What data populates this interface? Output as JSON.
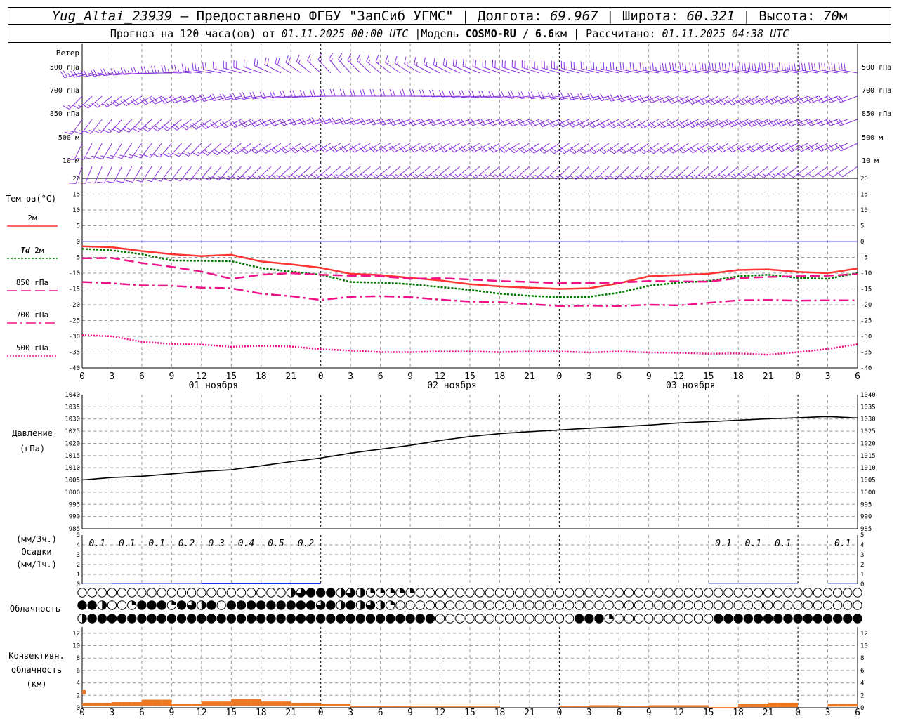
{
  "header": {
    "station": "Yug_Altai_23939",
    "provider": " — Предоставлено ФГБУ \"ЗапСиб УГМС\" | Долгота: ",
    "lon": "69.967",
    "lat_label": " | Широта: ",
    "lat": "60.321",
    "alt_label": " | Высота: ",
    "alt": "70",
    "alt_unit": "м",
    "forecast_prefix": "Прогноз на 120 часа(ов) от ",
    "forecast_start": "01.11.2025 00:00 UTC",
    "model_label": " |Модель ",
    "model_name": "COSMO-RU / 6.6",
    "model_unit": "км",
    "calc_label": " | Рассчитано: ",
    "calc_time": "01.11.2025 04:38 UTC"
  },
  "colors": {
    "t2m": "#ff3333",
    "td2m": "#007700",
    "t850": "#ee1188",
    "t700": "#ee1188",
    "t500": "#ee1188",
    "pressure": "#000000",
    "precip": "#1133ee",
    "convective": "#ee7722",
    "wind": "#8833dd",
    "zero_line": "#5555ff"
  },
  "chart_data": [
    {
      "type": "wind-barbs",
      "title": "Ветер",
      "levels": [
        "500 гПа",
        "700 гПа",
        "850 гПа",
        "500 м",
        "10 м"
      ],
      "time_step_h": 1,
      "direction_from_deg": [
        [
          255,
          270,
          290,
          320,
          300,
          290,
          285,
          280,
          280,
          280
        ],
        [
          225,
          245,
          260,
          270,
          270,
          265,
          260,
          250,
          240,
          250
        ],
        [
          215,
          230,
          245,
          255,
          250,
          250,
          245,
          240,
          245,
          250
        ],
        [
          205,
          220,
          235,
          240,
          240,
          240,
          235,
          235,
          240,
          245
        ],
        [
          200,
          215,
          225,
          230,
          230,
          230,
          225,
          225,
          230,
          235
        ]
      ],
      "speed_knots": [
        [
          25,
          25,
          20,
          15,
          15,
          20,
          25,
          25,
          35,
          30
        ],
        [
          15,
          20,
          20,
          20,
          20,
          20,
          20,
          20,
          25,
          20
        ],
        [
          15,
          20,
          20,
          20,
          20,
          20,
          20,
          20,
          25,
          20
        ],
        [
          15,
          15,
          20,
          20,
          20,
          20,
          20,
          20,
          20,
          20
        ],
        [
          10,
          10,
          15,
          15,
          15,
          15,
          15,
          15,
          15,
          10
        ]
      ]
    },
    {
      "type": "line",
      "title": "Тем-ра(°С)",
      "x_ticks": [
        "0",
        "3",
        "6",
        "9",
        "12",
        "15",
        "18",
        "21",
        "0",
        "3",
        "6",
        "9",
        "12",
        "15",
        "18",
        "21",
        "0",
        "3",
        "6",
        "9",
        "12",
        "15",
        "18",
        "21",
        "0",
        "3",
        "6"
      ],
      "day_labels": [
        "01 ноября",
        "02 ноября",
        "03 ноября"
      ],
      "ylim": [
        -40,
        20
      ],
      "yticks": [
        20,
        15,
        10,
        5,
        0,
        -5,
        -10,
        -15,
        -20,
        -25,
        -30,
        -35,
        -40
      ],
      "series": [
        {
          "name": "2м",
          "style": "solid",
          "hours": [
            0,
            3,
            6,
            9,
            12,
            15,
            18,
            21,
            24,
            27,
            30,
            33,
            36,
            39,
            42,
            45,
            48,
            51,
            54,
            57,
            60,
            63,
            66,
            69,
            72,
            75,
            78
          ],
          "values": [
            -1.5,
            -1.8,
            -3,
            -4,
            -4.6,
            -4.2,
            -6.3,
            -7.2,
            -8.3,
            -10.2,
            -10.6,
            -11.5,
            -12.3,
            -13.5,
            -14.2,
            -14.6,
            -15,
            -14.8,
            -13.2,
            -11,
            -10.6,
            -10.2,
            -9,
            -8.8,
            -9.6,
            -10,
            -8.5
          ]
        },
        {
          "name": "Td 2м",
          "style": "dotted",
          "hours": [
            0,
            3,
            6,
            9,
            12,
            15,
            18,
            21,
            24,
            27,
            30,
            33,
            36,
            39,
            42,
            45,
            48,
            51,
            54,
            57,
            60,
            63,
            66,
            69,
            72,
            75,
            78
          ],
          "values": [
            -2.3,
            -2.8,
            -4,
            -6,
            -6.1,
            -6.2,
            -8.4,
            -9.5,
            -10.5,
            -12.8,
            -13,
            -13.5,
            -14.4,
            -15.3,
            -16.5,
            -17.2,
            -17.6,
            -17.5,
            -16.2,
            -14,
            -13,
            -12.5,
            -11,
            -10.5,
            -11.5,
            -11.8,
            -10
          ]
        },
        {
          "name": "850 гПа",
          "style": "dashed",
          "hours": [
            0,
            3,
            6,
            9,
            12,
            15,
            18,
            21,
            24,
            27,
            30,
            33,
            36,
            39,
            42,
            45,
            48,
            51,
            54,
            57,
            60,
            63,
            66,
            69,
            72,
            75,
            78
          ],
          "values": [
            -5.3,
            -5.2,
            -6.8,
            -8,
            -9.5,
            -11.8,
            -10.5,
            -10,
            -10.5,
            -10.8,
            -11,
            -11.8,
            -11.6,
            -12,
            -12.5,
            -12.8,
            -13.2,
            -13.1,
            -13,
            -12.5,
            -12.6,
            -12.7,
            -11.6,
            -11.2,
            -11,
            -10.8,
            -10.3
          ]
        },
        {
          "name": "700 гПа",
          "style": "dashdot",
          "hours": [
            0,
            3,
            6,
            9,
            12,
            15,
            18,
            21,
            24,
            27,
            30,
            33,
            36,
            39,
            42,
            45,
            48,
            51,
            54,
            57,
            60,
            63,
            66,
            69,
            72,
            75,
            78
          ],
          "values": [
            -12.8,
            -13.2,
            -13.9,
            -14,
            -14.6,
            -14.8,
            -16.5,
            -17.3,
            -18.5,
            -17.5,
            -17.3,
            -17.6,
            -18.4,
            -19,
            -19.2,
            -19.8,
            -20.4,
            -20.3,
            -20.4,
            -20,
            -20.2,
            -19.4,
            -18.6,
            -18.5,
            -18.7,
            -18.6,
            -18.6
          ]
        },
        {
          "name": "500 гПа",
          "style": "fine-dotted",
          "hours": [
            0,
            3,
            6,
            9,
            12,
            15,
            18,
            21,
            24,
            27,
            30,
            33,
            36,
            39,
            42,
            45,
            48,
            51,
            54,
            57,
            60,
            63,
            66,
            69,
            72,
            75,
            78
          ],
          "values": [
            -29.6,
            -30,
            -31.7,
            -32.4,
            -32.6,
            -33.3,
            -33,
            -33.2,
            -34.1,
            -34.5,
            -35,
            -35,
            -34.8,
            -34.8,
            -35,
            -34.8,
            -34.8,
            -35.1,
            -34.8,
            -35.1,
            -35.2,
            -35.5,
            -35.4,
            -35.8,
            -35,
            -34,
            -32.5
          ]
        }
      ]
    },
    {
      "type": "line",
      "title": "Давление",
      "unit": "(гПа)",
      "ylim": [
        985,
        1040
      ],
      "yticks": [
        1040,
        1035,
        1030,
        1025,
        1020,
        1015,
        1010,
        1005,
        1000,
        995,
        990,
        985
      ],
      "hours": [
        0,
        3,
        6,
        9,
        12,
        15,
        18,
        21,
        24,
        27,
        30,
        33,
        36,
        39,
        42,
        45,
        48,
        51,
        54,
        57,
        60,
        63,
        66,
        69,
        72,
        75,
        78
      ],
      "values": [
        1005,
        1006,
        1006.5,
        1007.5,
        1008.5,
        1009.2,
        1010.8,
        1012.5,
        1014,
        1016,
        1017.6,
        1019.2,
        1021.2,
        1022.8,
        1024,
        1024.8,
        1025.5,
        1026.2,
        1026.8,
        1027.5,
        1028.4,
        1028.9,
        1029.5,
        1030.1,
        1030.5,
        1031,
        1030.4
      ]
    },
    {
      "type": "bar",
      "title": "Осадки",
      "unit3h": "(мм/3ч.)",
      "unit1h": "(мм/1ч.)",
      "ylim": [
        0,
        5
      ],
      "yticks": [
        5,
        4,
        3,
        2,
        1,
        0
      ],
      "amount_labels": [
        {
          "hour": 1.5,
          "text": "0.1"
        },
        {
          "hour": 4.5,
          "text": "0.1"
        },
        {
          "hour": 7.5,
          "text": "0.1"
        },
        {
          "hour": 10.5,
          "text": "0.2"
        },
        {
          "hour": 13.5,
          "text": "0.3"
        },
        {
          "hour": 16.5,
          "text": "0.4"
        },
        {
          "hour": 19.5,
          "text": "0.5"
        },
        {
          "hour": 22.5,
          "text": "0.2"
        },
        {
          "hour": 64.5,
          "text": "0.1"
        },
        {
          "hour": 67.5,
          "text": "0.1"
        },
        {
          "hour": 70.5,
          "text": "0.1"
        },
        {
          "hour": 76.5,
          "text": "0.1"
        }
      ],
      "hours": [
        0,
        3,
        6,
        9,
        12,
        15,
        18,
        21,
        24,
        27,
        30,
        33,
        36,
        39,
        42,
        45,
        48,
        51,
        54,
        57,
        60,
        63,
        66,
        69,
        72,
        75,
        78
      ],
      "values_1h": [
        0.02,
        0.04,
        0.04,
        0.04,
        0.07,
        0.1,
        0.13,
        0.1,
        0,
        0,
        0,
        0,
        0,
        0,
        0,
        0,
        0,
        0,
        0,
        0,
        0,
        0.03,
        0.03,
        0.03,
        0,
        0.03,
        0.03
      ]
    },
    {
      "type": "cloud-symbols",
      "title": "Облачность",
      "time_step_h": 1,
      "rows": [
        {
          "level": "upper",
          "cover_eighths": [
            [
              0,
              0
            ],
            [
              20,
              0
            ],
            [
              21,
              4
            ],
            [
              22,
              6
            ],
            [
              23,
              8
            ],
            [
              25,
              8
            ],
            [
              26,
              4
            ],
            [
              27,
              6
            ],
            [
              28,
              4
            ],
            [
              29,
              2
            ],
            [
              33,
              2
            ],
            [
              34,
              0
            ],
            [
              78,
              0
            ]
          ]
        },
        {
          "level": "middle",
          "cover_eighths": [
            [
              0,
              8
            ],
            [
              1,
              8
            ],
            [
              2,
              4
            ],
            [
              3,
              0
            ],
            [
              5,
              2
            ],
            [
              6,
              8
            ],
            [
              9,
              2
            ],
            [
              10,
              8
            ],
            [
              11,
              6
            ],
            [
              12,
              4
            ],
            [
              13,
              8
            ],
            [
              14,
              0
            ],
            [
              15,
              8
            ],
            [
              23,
              8
            ],
            [
              24,
              6
            ],
            [
              25,
              8
            ],
            [
              26,
              4
            ],
            [
              27,
              8
            ],
            [
              28,
              4
            ],
            [
              29,
              6
            ],
            [
              30,
              4
            ],
            [
              31,
              2
            ],
            [
              32,
              0
            ],
            [
              78,
              0
            ]
          ]
        },
        {
          "level": "lower",
          "cover_eighths": [
            [
              0,
              4
            ],
            [
              1,
              8
            ],
            [
              35,
              8
            ],
            [
              36,
              0
            ],
            [
              49,
              0
            ],
            [
              50,
              8
            ],
            [
              52,
              8
            ],
            [
              53,
              2
            ],
            [
              54,
              0
            ],
            [
              63,
              0
            ],
            [
              64,
              8
            ],
            [
              78,
              8
            ]
          ]
        }
      ]
    },
    {
      "type": "bar",
      "title": "Конвективн. облачность",
      "unit": "(км)",
      "ylim": [
        0,
        13
      ],
      "yticks": [
        12,
        10,
        8,
        6,
        4,
        2,
        0
      ],
      "hours": [
        0,
        3,
        6,
        9,
        12,
        15,
        18,
        21,
        24,
        27,
        30,
        33,
        36,
        39,
        42,
        45,
        48,
        51,
        54,
        57,
        60,
        63,
        66,
        69,
        72,
        75,
        78
      ],
      "top_km": [
        0.8,
        0.9,
        1.3,
        0.6,
        1.0,
        1.4,
        1.0,
        0.8,
        0.6,
        0.3,
        0.3,
        0.2,
        0.2,
        0.2,
        0.1,
        0,
        0.3,
        0.4,
        0.3,
        0.4,
        0.4,
        0.1,
        0.6,
        0.8,
        0,
        0.6,
        0.8
      ],
      "base_km": [
        0.3,
        0.3,
        0.3,
        0.3,
        0.3,
        0.3,
        0.3,
        0.3,
        0.3,
        0.1,
        0.1,
        0.1,
        0.1,
        0.1,
        0.1,
        0,
        0.1,
        0.1,
        0.1,
        0.1,
        0.1,
        0.05,
        0.1,
        0.1,
        0,
        0.2,
        0.2
      ]
    }
  ]
}
